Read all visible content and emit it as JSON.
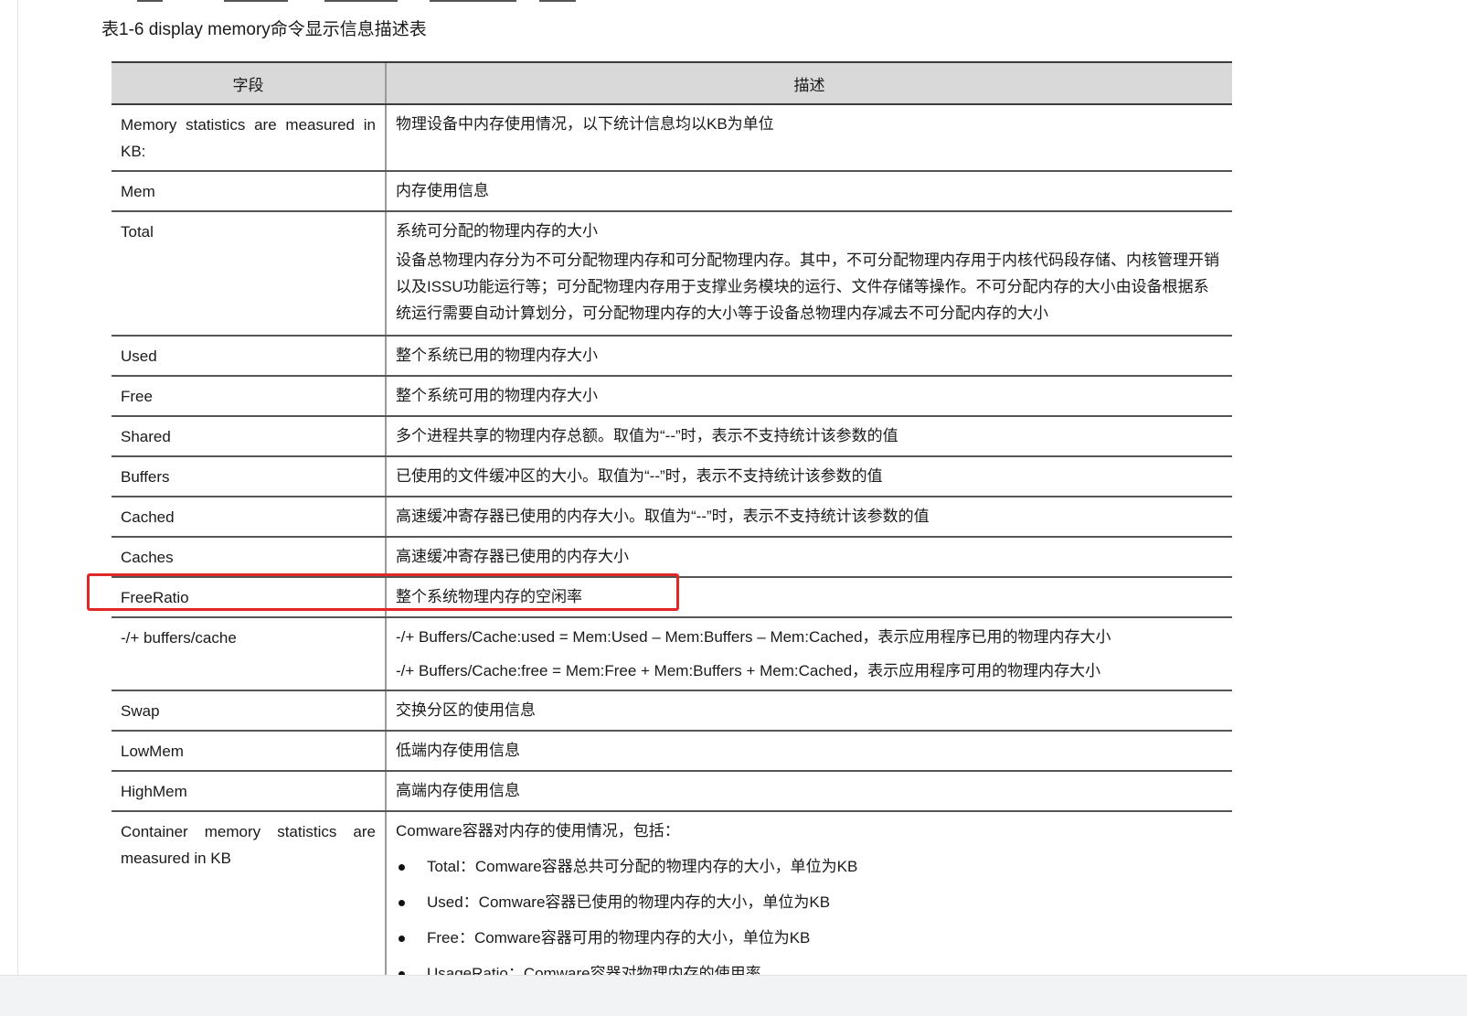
{
  "caption": "表1-6 display memory命令显示信息描述表",
  "table": {
    "headers": [
      "字段",
      "描述"
    ],
    "rows": [
      {
        "field": "Memory statistics are measured in KB:",
        "desc": [
          "物理设备中内存使用情况，以下统计信息均以KB为单位"
        ]
      },
      {
        "field": "Mem",
        "desc": [
          "内存使用信息"
        ]
      },
      {
        "field": "Total",
        "desc": [
          "系统可分配的物理内存的大小"
        ],
        "para": "设备总物理内存分为不可分配物理内存和可分配物理内存。其中，不可分配物理内存用于内核代码段存储、内核管理开销以及ISSU功能运行等；可分配物理内存用于支撑业务模块的运行、文件存储等操作。不可分配内存的大小由设备根据系统运行需要自动计算划分，可分配物理内存的大小等于设备总物理内存减去不可分配内存的大小"
      },
      {
        "field": "Used",
        "desc": [
          "整个系统已用的物理内存大小"
        ]
      },
      {
        "field": "Free",
        "desc": [
          "整个系统可用的物理内存大小"
        ]
      },
      {
        "field": "Shared",
        "desc": [
          "多个进程共享的物理内存总额。取值为“--”时，表示不支持统计该参数的值"
        ]
      },
      {
        "field": "Buffers",
        "desc": [
          "已使用的文件缓冲区的大小。取值为“--”时，表示不支持统计该参数的值"
        ]
      },
      {
        "field": "Cached",
        "desc": [
          "高速缓冲寄存器已使用的内存大小。取值为“--”时，表示不支持统计该参数的值"
        ]
      },
      {
        "field": "Caches",
        "desc": [
          "高速缓冲寄存器已使用的内存大小"
        ]
      },
      {
        "field": "FreeRatio",
        "desc": [
          "整个系统物理内存的空闲率"
        ]
      },
      {
        "field": "-/+ buffers/cache",
        "desc": [
          "-/+ Buffers/Cache:used = Mem:Used – Mem:Buffers – Mem:Cached，表示应用程序已用的物理内存大小",
          "-/+ Buffers/Cache:free = Mem:Free + Mem:Buffers + Mem:Cached，表示应用程序可用的物理内存大小"
        ]
      },
      {
        "field": "Swap",
        "desc": [
          "交换分区的使用信息"
        ]
      },
      {
        "field": "LowMem",
        "desc": [
          "低端内存使用信息"
        ]
      },
      {
        "field": "HighMem",
        "desc": [
          "高端内存使用信息"
        ]
      },
      {
        "field": "Container memory statistics are measured in KB",
        "desc": [
          "Comware容器对内存的使用情况，包括："
        ],
        "bullets": [
          "Total：Comware容器总共可分配的物理内存的大小，单位为KB",
          "Used：Comware容器已使用的物理内存的大小，单位为KB",
          "Free：Comware容器可用的物理内存的大小，单位为KB",
          "UsageRatio：Comware容器对物理内存的使用率"
        ]
      }
    ]
  },
  "highlight": {
    "row_field": "FreeRatio",
    "color": "#e02828"
  }
}
